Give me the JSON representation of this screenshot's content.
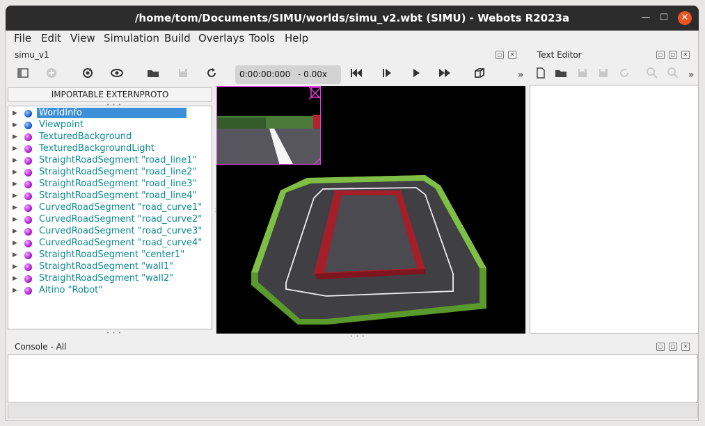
{
  "window": {
    "title": "/home/tom/Documents/SIMU/worlds/simu_v2.wbt (SIMU) - Webots R2023a",
    "minimize_glyph": "—",
    "maximize_glyph": "☐",
    "close_glyph": "✕",
    "close_color": "#e95420"
  },
  "menu": {
    "file": "File",
    "edit": "Edit",
    "view": "View",
    "simulation": "Simulation",
    "build": "Build",
    "overlays": "Overlays",
    "tools": "Tools",
    "help": "Help"
  },
  "scene_panel": {
    "title": "simu_v1",
    "float_glyph": "◻",
    "close_glyph": "✕"
  },
  "toolbar": {
    "time": "0:00:00:000",
    "speed": "-  0.00x",
    "more_glyph": "»",
    "icons": [
      "scene-tree-toggle-icon",
      "add-node-icon",
      "reset-simulation-icon",
      "view-icon",
      "open-world-icon",
      "save-world-icon",
      "reload-world-icon",
      "step-back-icon",
      "step-icon",
      "play-icon",
      "fast-forward-icon",
      "3d-box-icon"
    ]
  },
  "text_editor": {
    "title": "Text Editor",
    "more_glyph": "»",
    "icons": [
      "new-file-icon",
      "open-file-icon",
      "save-file-icon",
      "save-as-icon",
      "revert-icon",
      "find-icon",
      "replace-icon"
    ]
  },
  "scene_tree": {
    "importable_button": "IMPORTABLE EXTERNPROTO",
    "items": [
      {
        "label": "WorldInfo",
        "color": "blue",
        "selected": true
      },
      {
        "label": "Viewpoint",
        "color": "blue"
      },
      {
        "label": "TexturedBackground",
        "color": "purple"
      },
      {
        "label": "TexturedBackgroundLight",
        "color": "purple"
      },
      {
        "label": "StraightRoadSegment \"road_line1\"",
        "color": "purple"
      },
      {
        "label": "StraightRoadSegment \"road_line2\"",
        "color": "purple"
      },
      {
        "label": "StraightRoadSegment \"road_line3\"",
        "color": "purple"
      },
      {
        "label": "StraightRoadSegment \"road_line4\"",
        "color": "purple"
      },
      {
        "label": "CurvedRoadSegment \"road_curve1\"",
        "color": "purple"
      },
      {
        "label": "CurvedRoadSegment \"road_curve2\"",
        "color": "purple"
      },
      {
        "label": "CurvedRoadSegment \"road_curve3\"",
        "color": "purple"
      },
      {
        "label": "CurvedRoadSegment \"road_curve4\"",
        "color": "purple"
      },
      {
        "label": "StraightRoadSegment \"center1\"",
        "color": "purple"
      },
      {
        "label": "StraightRoadSegment \"wall1\"",
        "color": "purple"
      },
      {
        "label": "StraightRoadSegment \"wall2\"",
        "color": "purple"
      },
      {
        "label": "Altino \"Robot\"",
        "color": "purple"
      }
    ]
  },
  "console": {
    "title": "Console - All"
  },
  "colors": {
    "selection": "#3d8fd8",
    "node_text": "#0d8a8f",
    "camera_border": "#e23ee2",
    "track_wall_green": "#5f9b2e",
    "center_block_red": "#b0252f",
    "asphalt": "#3f3f44"
  }
}
